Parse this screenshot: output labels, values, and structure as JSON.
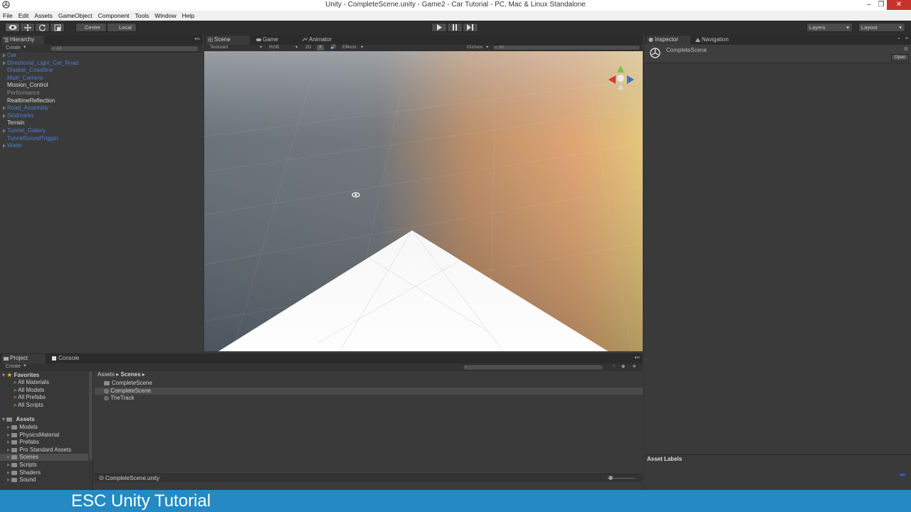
{
  "window": {
    "title": "Unity - CompleteScene.unity - Game2 - Car Tutorial - PC, Mac & Linux Standalone",
    "minimize_glyph": "–",
    "restore_glyph": "❐",
    "close_glyph": "✕"
  },
  "menu": [
    "File",
    "Edit",
    "Assets",
    "GameObject",
    "Component",
    "Tools",
    "Window",
    "Help"
  ],
  "toolbar": {
    "pivot_label": "Center",
    "space_label": "Local",
    "layers_label": "Layers",
    "layout_label": "Layout"
  },
  "hierarchy": {
    "tab": "Hierarchy",
    "create": "Create",
    "search_placeholder": "All",
    "items": [
      {
        "label": "Car",
        "style": "blue",
        "arrow": true
      },
      {
        "label": "Directional_Light_Car_Road",
        "style": "blue",
        "arrow": true
      },
      {
        "label": "Disable_Coastline",
        "style": "blue",
        "arrow": false
      },
      {
        "label": "Main_Camera",
        "style": "blue",
        "arrow": false
      },
      {
        "label": "Mission_Control",
        "style": "white",
        "arrow": false
      },
      {
        "label": "Performance",
        "style": "grey",
        "arrow": false
      },
      {
        "label": "RealtimeReflection",
        "style": "white",
        "arrow": false
      },
      {
        "label": "Road_Assembly",
        "style": "blue",
        "arrow": true
      },
      {
        "label": "Skidmarks",
        "style": "blue",
        "arrow": true
      },
      {
        "label": "Terrain",
        "style": "white",
        "arrow": false
      },
      {
        "label": "Tunnel_Gallery",
        "style": "blue",
        "arrow": true
      },
      {
        "label": "TunnelSoundTrigger",
        "style": "blue",
        "arrow": false
      },
      {
        "label": "Water",
        "style": "blue",
        "arrow": true
      }
    ]
  },
  "scene_tabs": {
    "scene": "Scene",
    "game": "Game",
    "animator": "Animator"
  },
  "scene_bar": {
    "draw_mode": "Textured",
    "render_mode": "RGB",
    "mode_2d": "2D",
    "effects": "Effects",
    "gizmos": "Gizmos",
    "search_placeholder": "All"
  },
  "inspector": {
    "tab": "Inspector",
    "nav_tab": "Navigation",
    "object_name": "CompleteScene",
    "open_button": "Open",
    "asset_labels": "Asset Labels"
  },
  "project": {
    "tab": "Project",
    "console_tab": "Console",
    "create": "Create",
    "favorites_label": "Favorites",
    "favorites": [
      "All Materials",
      "All Models",
      "All Prefabs",
      "All Scripts"
    ],
    "assets_label": "Assets",
    "asset_folders": [
      "Models",
      "PhysicsMaterial",
      "Prefabs",
      "Pro Standard Assets",
      "Scenes",
      "Scripts",
      "Shaders",
      "Sound"
    ],
    "selected_folder": "Scenes",
    "breadcrumb": {
      "root": "Assets",
      "current": "Scenes"
    },
    "files": [
      {
        "label": "CompleteScene",
        "kind": "folder"
      },
      {
        "label": "CompleteScene",
        "kind": "scene",
        "selected": true
      },
      {
        "label": "TheTrack",
        "kind": "scene"
      }
    ],
    "status_path": "CompleteScene.unity"
  },
  "banner": {
    "text": "ESC Unity Tutorial"
  },
  "colors": {
    "accent_blue": "#2589c3",
    "hierarchy_prefab_blue": "#4d7fcf",
    "close_red": "#c7332b"
  }
}
